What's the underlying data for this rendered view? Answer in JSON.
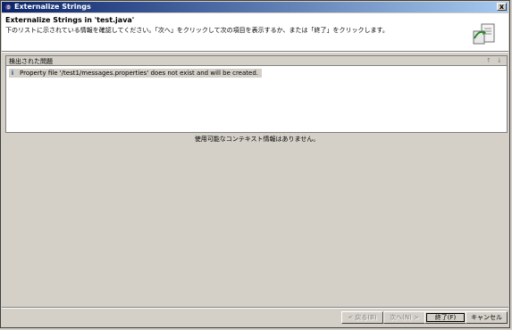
{
  "window": {
    "title": "Externalize Strings",
    "close_label": "x"
  },
  "banner": {
    "heading": "Externalize Strings in 'test.java'",
    "description": "下のリストに示されている情報を確認してください。「次へ」をクリックして次の項目を表示するか、または「終了」をクリックします。",
    "icon": "externalize-wizard-icon"
  },
  "problems": {
    "header_label": "検出された問題",
    "nav_up": "↑",
    "nav_down": "↓",
    "items": [
      {
        "icon": "info-icon",
        "message": "Property file '/test1/messages.properties' does not exist and will be created."
      }
    ]
  },
  "context_message": "使用可能なコンテキスト情報はありません。",
  "buttons": {
    "back": "< 戻る(B)",
    "next": "次へ(N) >",
    "finish": "終了(F)",
    "cancel": "キャンセル"
  },
  "colors": {
    "titlebar_start": "#0a246a",
    "titlebar_end": "#a6caf0",
    "dialog_bg": "#d4d0c8"
  }
}
